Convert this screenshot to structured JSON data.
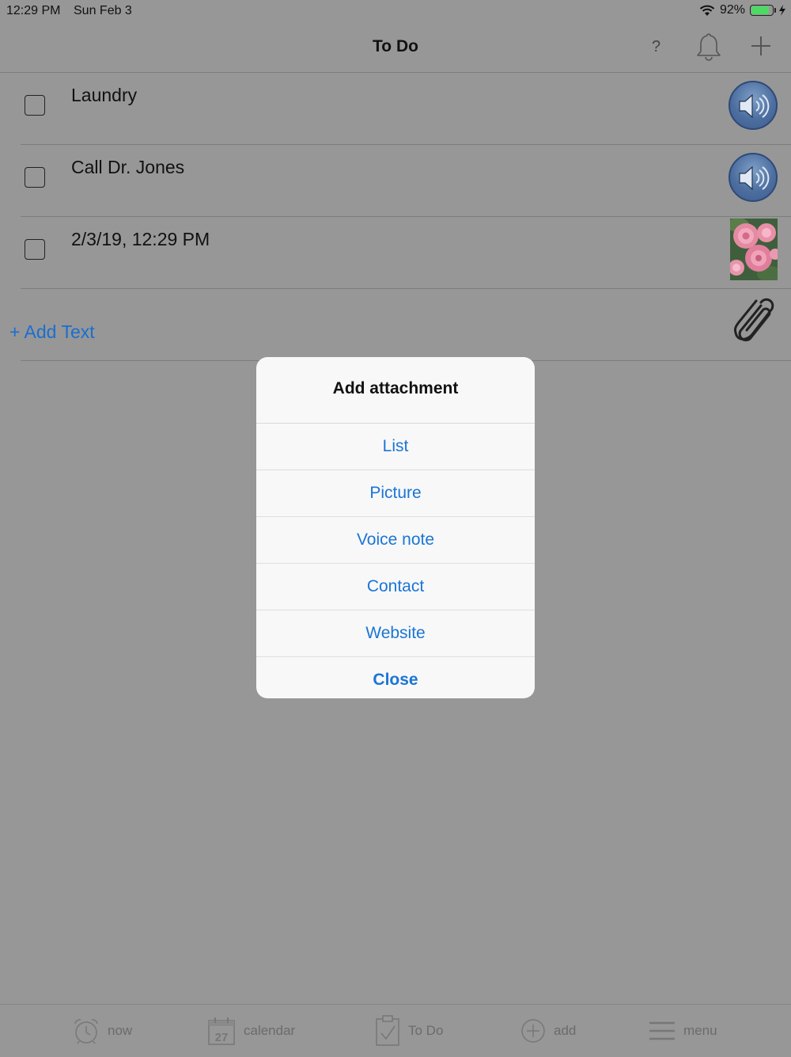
{
  "status_bar": {
    "time": "12:29 PM",
    "date": "Sun Feb 3",
    "battery_percent": "92%",
    "battery_level": 0.92,
    "icons": [
      "wifi-icon",
      "battery-icon",
      "charging-bolt-icon"
    ]
  },
  "nav": {
    "title": "To Do",
    "help_label": "?",
    "icons": [
      "bell-icon",
      "plus-icon"
    ]
  },
  "todos": [
    {
      "text": "Laundry",
      "attachment": "speaker-icon",
      "checked": false
    },
    {
      "text": "Call Dr. Jones",
      "attachment": "speaker-icon",
      "checked": false
    },
    {
      "text": "2/3/19, 12:29 PM",
      "attachment": "photo-thumbnail",
      "checked": false
    }
  ],
  "add_text_label": "+ Add Text",
  "dialog": {
    "title": "Add attachment",
    "options": [
      "List",
      "Picture",
      "Voice note",
      "Contact",
      "Website"
    ],
    "close_label": "Close"
  },
  "tab_bar": {
    "items": [
      {
        "label": "now",
        "icon": "alarm-clock-icon"
      },
      {
        "label": "calendar",
        "icon": "calendar-icon",
        "icon_text": "27"
      },
      {
        "label": "To Do",
        "icon": "clipboard-check-icon"
      },
      {
        "label": "add",
        "icon": "plus-circle-icon"
      },
      {
        "label": "menu",
        "icon": "hamburger-menu-icon"
      }
    ]
  },
  "colors": {
    "overlay_background": "#979797",
    "accent": "#1a75d6",
    "dialog_background": "#f8f8f8",
    "battery_green": "#4cd964"
  }
}
